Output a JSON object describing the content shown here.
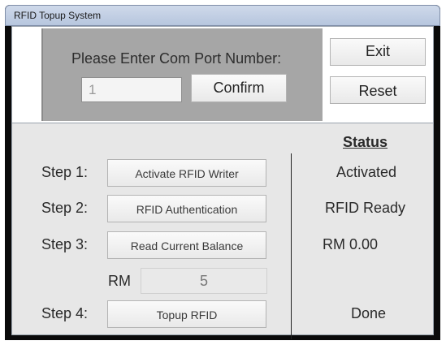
{
  "window": {
    "title": "RFID Topup System"
  },
  "com_port": {
    "prompt": "Please Enter Com Port Number:",
    "value": "1",
    "confirm_label": "Confirm"
  },
  "actions": {
    "exit_label": "Exit",
    "reset_label": "Reset"
  },
  "status_heading": "Status",
  "steps": [
    {
      "label": "Step 1:",
      "button": "Activate RFID Writer",
      "status": "Activated"
    },
    {
      "label": "Step 2:",
      "button": "RFID Authentication",
      "status": "RFID Ready"
    },
    {
      "label": "Step 3:",
      "button": "Read Current Balance",
      "status": "RM 0.00"
    },
    {
      "label": "Step 4:",
      "button": "Topup RFID",
      "status": "Done"
    }
  ],
  "topup": {
    "currency_label": "RM",
    "amount": "5"
  }
}
